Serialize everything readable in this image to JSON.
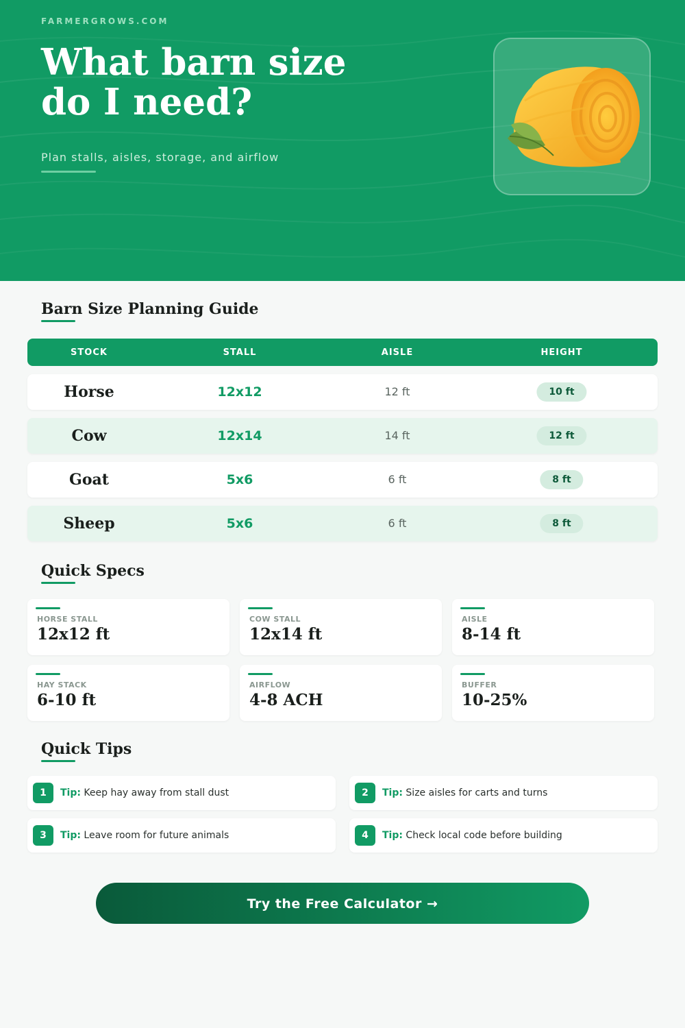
{
  "hero": {
    "site": "FARMERGROWS.COM",
    "title_line1": "What barn size",
    "title_line2": "do I need?",
    "subtitle": "Plan stalls, aisles, storage, and airflow",
    "image_icon": "hay-bale-icon",
    "bg_color": "#119b64"
  },
  "guide": {
    "title": "Barn Size Planning Guide",
    "columns": [
      "STOCK",
      "STALL",
      "AISLE",
      "HEIGHT"
    ],
    "rows": [
      {
        "stock": "Horse",
        "stall": "12x12",
        "aisle": "12 ft",
        "height": "10 ft"
      },
      {
        "stock": "Cow",
        "stall": "12x14",
        "aisle": "14 ft",
        "height": "12 ft"
      },
      {
        "stock": "Goat",
        "stall": "5x6",
        "aisle": "6 ft",
        "height": "8 ft"
      },
      {
        "stock": "Sheep",
        "stall": "5x6",
        "aisle": "6 ft",
        "height": "8 ft"
      }
    ]
  },
  "specs": {
    "title": "Quick Specs",
    "items": [
      {
        "label": "HORSE STALL",
        "value": "12x12 ft"
      },
      {
        "label": "COW STALL",
        "value": "12x14 ft"
      },
      {
        "label": "AISLE",
        "value": "8-14 ft"
      },
      {
        "label": "HAY STACK",
        "value": "6-10 ft"
      },
      {
        "label": "AIRFLOW",
        "value": "4-8 ACH"
      },
      {
        "label": "BUFFER",
        "value": "10-25%"
      }
    ]
  },
  "tips": {
    "title": "Quick Tips",
    "prefix": "Tip:",
    "items": [
      {
        "num": "1",
        "text": "Keep hay away from stall dust"
      },
      {
        "num": "2",
        "text": "Size aisles for carts and turns"
      },
      {
        "num": "3",
        "text": "Leave room for future animals"
      },
      {
        "num": "4",
        "text": "Check local code before building"
      }
    ]
  },
  "cta": {
    "label": "Try the Free Calculator →"
  },
  "colors": {
    "accent": "#119b64",
    "accent_dark": "#0a5a3a",
    "row_alt": "#e6f5ed",
    "badge": "#d4ecdf"
  }
}
